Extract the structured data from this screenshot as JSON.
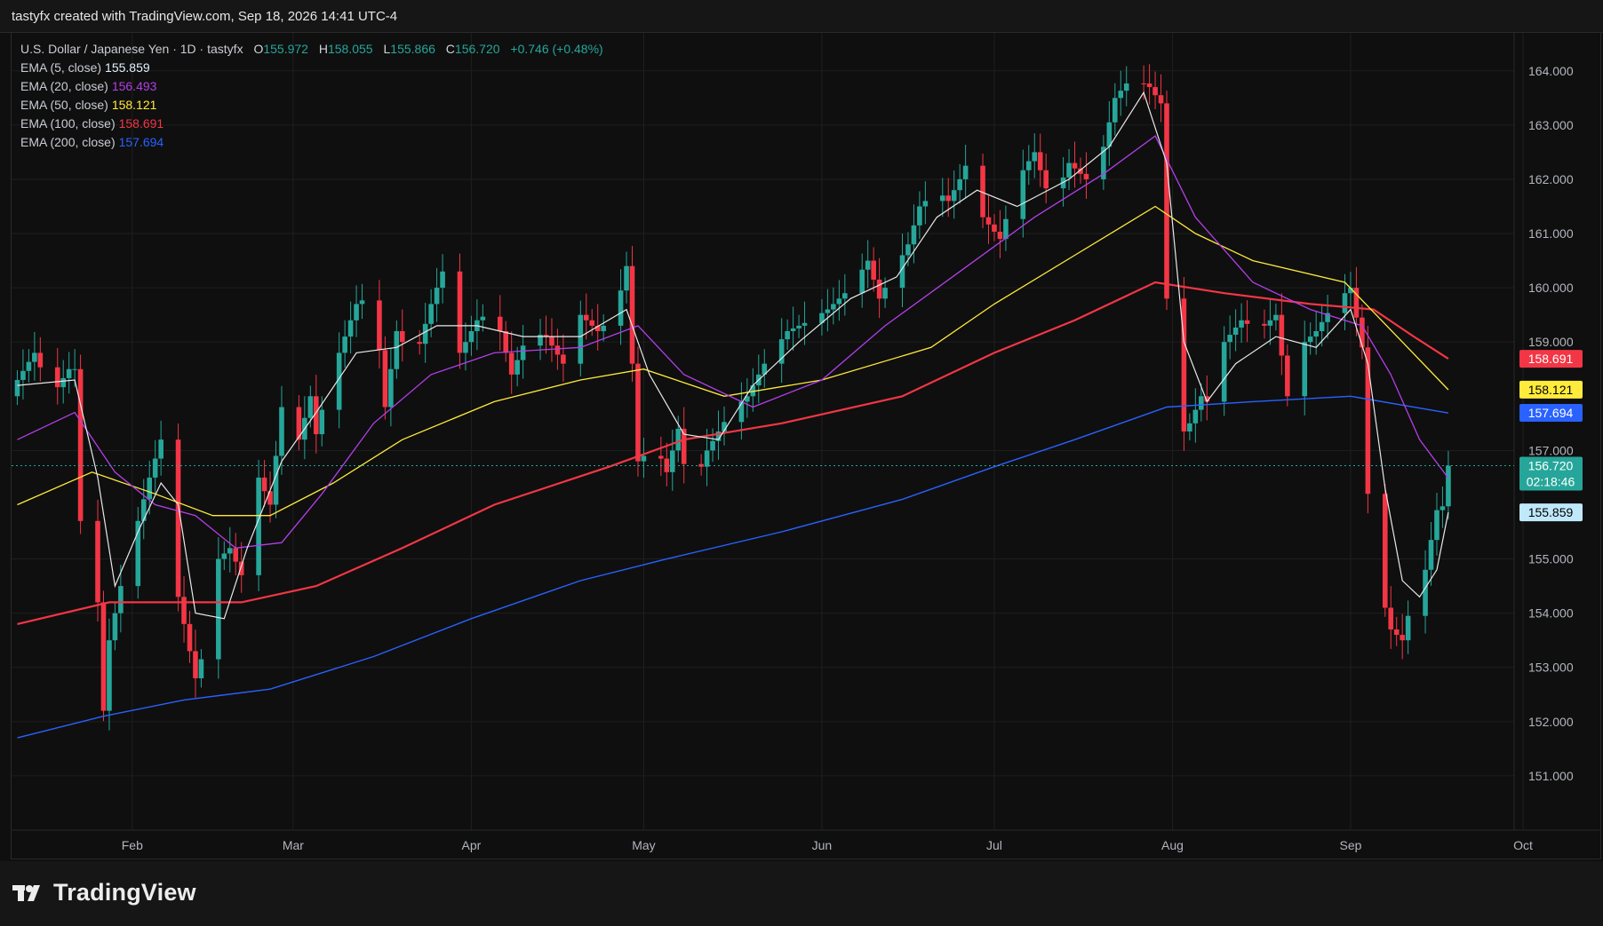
{
  "header": {
    "credit": "tastyfx created with TradingView.com, Sep 18, 2026 14:41 UTC-4"
  },
  "legend": {
    "symbol": "U.S. Dollar / Japanese Yen · 1D · tastyfx",
    "ohlc": [
      {
        "k": "O",
        "v": "155.972"
      },
      {
        "k": "H",
        "v": "158.055"
      },
      {
        "k": "L",
        "v": "155.866"
      },
      {
        "k": "C",
        "v": "156.720"
      }
    ],
    "change": "+0.746 (+0.48%)",
    "indicators": [
      {
        "label": "EMA (5, close)",
        "value": "155.859",
        "color": "#e0f0ff"
      },
      {
        "label": "EMA (20, close)",
        "value": "156.493",
        "color": "#b23fe8"
      },
      {
        "label": "EMA (50, close)",
        "value": "158.121",
        "color": "#ffeb3b"
      },
      {
        "label": "EMA (100, close)",
        "value": "158.691",
        "color": "#f23645"
      },
      {
        "label": "EMA (200, close)",
        "value": "157.694",
        "color": "#2962ff"
      }
    ]
  },
  "brand": {
    "name": "TradingView",
    "icon": "tradingview-logo-icon"
  },
  "colors": {
    "up": "#26a69a",
    "down": "#f23645",
    "background": "#0f0f0f",
    "grid": "#1f1f1f",
    "ema5": "#e8e8e8",
    "ema20": "#b23fe8",
    "ema50": "#ffeb3b",
    "ema100": "#f23645",
    "ema200": "#2962ff"
  },
  "chart_data": {
    "type": "candlestick",
    "title": "U.S. Dollar / Japanese Yen · 1D · tastyfx",
    "ylim": [
      150.0,
      164.7
    ],
    "y_ticks": [
      "151.000",
      "152.000",
      "153.000",
      "154.000",
      "155.000",
      "157.000",
      "159.000",
      "160.000",
      "161.000",
      "162.000",
      "163.000",
      "164.000"
    ],
    "x_ticks": [
      {
        "label": "Feb",
        "date": "2026-02-01"
      },
      {
        "label": "Mar",
        "date": "2026-03-01"
      },
      {
        "label": "Apr",
        "date": "2026-04-01"
      },
      {
        "label": "May",
        "date": "2026-05-01"
      },
      {
        "label": "Jun",
        "date": "2026-06-01"
      },
      {
        "label": "Jul",
        "date": "2026-07-01"
      },
      {
        "label": "Aug",
        "date": "2026-08-01"
      },
      {
        "label": "Sep",
        "date": "2026-09-01"
      },
      {
        "label": "Oct",
        "date": "2026-10-01"
      }
    ],
    "x_range": [
      "2026-01-11",
      "2026-10-01"
    ],
    "grid": true,
    "last_price": {
      "value": 156.72,
      "label": "156.720",
      "countdown": "02:18:46"
    },
    "price_labels": [
      {
        "label": "158.691",
        "value": 158.691,
        "color": "#f23645",
        "text_color": "#ffffff"
      },
      {
        "label": "158.121",
        "value": 158.121,
        "color": "#ffeb3b",
        "text_color": "#000000"
      },
      {
        "label": "157.694",
        "value": 157.694,
        "color": "#2962ff",
        "text_color": "#ffffff"
      },
      {
        "label": "156.493",
        "value": 156.493,
        "color": "#b23fe8",
        "text_color": "#ffffff"
      },
      {
        "label": "155.859",
        "value": 155.859,
        "color": "#bfe8fb",
        "text_color": "#000000"
      }
    ],
    "price_path": [
      [
        "2026-01-12",
        158.3
      ],
      [
        "2026-01-15",
        158.8
      ],
      [
        "2026-01-18",
        158.0
      ],
      [
        "2026-01-21",
        158.5
      ],
      [
        "2026-01-22",
        158.5
      ],
      [
        "2026-01-23",
        155.7
      ],
      [
        "2026-01-26",
        154.2
      ],
      [
        "2026-01-27",
        152.2
      ],
      [
        "2026-01-28",
        153.5
      ],
      [
        "2026-01-30",
        154.5
      ],
      [
        "2026-02-02",
        155.7
      ],
      [
        "2026-02-04",
        156.5
      ],
      [
        "2026-02-06",
        157.2
      ],
      [
        "2026-02-08",
        157.3
      ],
      [
        "2026-02-09",
        154.3
      ],
      [
        "2026-02-12",
        152.8
      ],
      [
        "2026-02-14",
        153.5
      ],
      [
        "2026-02-16",
        155.0
      ],
      [
        "2026-02-18",
        155.2
      ],
      [
        "2026-02-20",
        154.7
      ],
      [
        "2026-02-23",
        156.5
      ],
      [
        "2026-02-25",
        156.0
      ],
      [
        "2026-02-27",
        157.8
      ],
      [
        "2026-03-02",
        157.2
      ],
      [
        "2026-03-04",
        158.0
      ],
      [
        "2026-03-05",
        157.3
      ],
      [
        "2026-03-07",
        158.2
      ],
      [
        "2026-03-10",
        159.1
      ],
      [
        "2026-03-12",
        159.7
      ],
      [
        "2026-03-15",
        159.9
      ],
      [
        "2026-03-17",
        157.8
      ],
      [
        "2026-03-19",
        159.2
      ],
      [
        "2026-03-22",
        158.6
      ],
      [
        "2026-03-25",
        159.7
      ],
      [
        "2026-03-27",
        160.3
      ],
      [
        "2026-03-29",
        158.6
      ],
      [
        "2026-04-02",
        159.4
      ],
      [
        "2026-04-05",
        159.6
      ],
      [
        "2026-04-08",
        158.4
      ],
      [
        "2026-04-11",
        159.2
      ],
      [
        "2026-04-14",
        159.1
      ],
      [
        "2026-04-17",
        158.6
      ],
      [
        "2026-04-20",
        159.5
      ],
      [
        "2026-04-23",
        159.2
      ],
      [
        "2026-04-26",
        159.5
      ],
      [
        "2026-04-28",
        160.4
      ],
      [
        "2026-04-30",
        156.8
      ],
      [
        "2026-05-03",
        157.1
      ],
      [
        "2026-05-05",
        156.6
      ],
      [
        "2026-05-07",
        157.4
      ],
      [
        "2026-05-09",
        156.1
      ],
      [
        "2026-05-12",
        157.0
      ],
      [
        "2026-05-16",
        157.7
      ],
      [
        "2026-05-19",
        158.0
      ],
      [
        "2026-05-22",
        158.6
      ],
      [
        "2026-05-26",
        159.2
      ],
      [
        "2026-05-30",
        159.4
      ],
      [
        "2026-06-02",
        159.6
      ],
      [
        "2026-06-06",
        160.0
      ],
      [
        "2026-06-09",
        160.5
      ],
      [
        "2026-06-11",
        159.8
      ],
      [
        "2026-06-14",
        160.4
      ],
      [
        "2026-06-16",
        160.8
      ],
      [
        "2026-06-18",
        161.5
      ],
      [
        "2026-06-21",
        161.8
      ],
      [
        "2026-06-23",
        161.6
      ],
      [
        "2026-06-25",
        162.0
      ],
      [
        "2026-06-27",
        162.5
      ],
      [
        "2026-06-29",
        161.3
      ],
      [
        "2026-07-02",
        160.9
      ],
      [
        "2026-07-05",
        162.0
      ],
      [
        "2026-07-08",
        162.5
      ],
      [
        "2026-07-11",
        161.5
      ],
      [
        "2026-07-14",
        162.3
      ],
      [
        "2026-07-17",
        162.0
      ],
      [
        "2026-07-20",
        162.6
      ],
      [
        "2026-07-22",
        163.5
      ],
      [
        "2026-07-25",
        163.9
      ],
      [
        "2026-07-28",
        163.7
      ],
      [
        "2026-07-30",
        163.4
      ],
      [
        "2026-07-31",
        159.8
      ],
      [
        "2026-08-02",
        157.2
      ],
      [
        "2026-08-04",
        157.5
      ],
      [
        "2026-08-06",
        158.0
      ],
      [
        "2026-08-08",
        157.8
      ],
      [
        "2026-08-10",
        159.0
      ],
      [
        "2026-08-13",
        159.4
      ],
      [
        "2026-08-16",
        159.2
      ],
      [
        "2026-08-19",
        159.5
      ],
      [
        "2026-08-21",
        158.0
      ],
      [
        "2026-08-23",
        158.9
      ],
      [
        "2026-08-26",
        159.2
      ],
      [
        "2026-08-29",
        159.7
      ],
      [
        "2026-09-01",
        160.0
      ],
      [
        "2026-09-03",
        158.9
      ],
      [
        "2026-09-04",
        156.2
      ],
      [
        "2026-09-06",
        154.5
      ],
      [
        "2026-09-08",
        153.7
      ],
      [
        "2026-09-10",
        153.5
      ],
      [
        "2026-09-12",
        154.4
      ],
      [
        "2026-09-14",
        154.8
      ],
      [
        "2026-09-16",
        155.9
      ],
      [
        "2026-09-17",
        155.97
      ],
      [
        "2026-09-18",
        156.72
      ]
    ],
    "ema5": [
      [
        "2026-01-12",
        158.2
      ],
      [
        "2026-01-22",
        158.3
      ],
      [
        "2026-01-26",
        156.5
      ],
      [
        "2026-01-29",
        154.5
      ],
      [
        "2026-02-02",
        155.5
      ],
      [
        "2026-02-06",
        156.4
      ],
      [
        "2026-02-09",
        156.0
      ],
      [
        "2026-02-12",
        154.0
      ],
      [
        "2026-02-17",
        153.9
      ],
      [
        "2026-02-21",
        155.2
      ],
      [
        "2026-02-27",
        156.8
      ],
      [
        "2026-03-05",
        157.7
      ],
      [
        "2026-03-12",
        158.8
      ],
      [
        "2026-03-19",
        158.9
      ],
      [
        "2026-03-26",
        159.3
      ],
      [
        "2026-04-02",
        159.3
      ],
      [
        "2026-04-10",
        159.1
      ],
      [
        "2026-04-20",
        159.1
      ],
      [
        "2026-04-28",
        159.6
      ],
      [
        "2026-05-02",
        158.4
      ],
      [
        "2026-05-08",
        157.3
      ],
      [
        "2026-05-14",
        157.2
      ],
      [
        "2026-05-20",
        158.2
      ],
      [
        "2026-05-28",
        159.0
      ],
      [
        "2026-06-06",
        159.8
      ],
      [
        "2026-06-14",
        160.2
      ],
      [
        "2026-06-21",
        161.3
      ],
      [
        "2026-06-28",
        161.8
      ],
      [
        "2026-07-05",
        161.5
      ],
      [
        "2026-07-14",
        162.0
      ],
      [
        "2026-07-21",
        162.6
      ],
      [
        "2026-07-27",
        163.6
      ],
      [
        "2026-07-31",
        162.3
      ],
      [
        "2026-08-03",
        159.0
      ],
      [
        "2026-08-07",
        157.9
      ],
      [
        "2026-08-12",
        158.6
      ],
      [
        "2026-08-19",
        159.1
      ],
      [
        "2026-08-26",
        158.9
      ],
      [
        "2026-09-01",
        159.6
      ],
      [
        "2026-09-04",
        158.6
      ],
      [
        "2026-09-07",
        156.3
      ],
      [
        "2026-09-10",
        154.6
      ],
      [
        "2026-09-13",
        154.3
      ],
      [
        "2026-09-16",
        154.8
      ],
      [
        "2026-09-18",
        155.86
      ]
    ],
    "ema20": [
      [
        "2026-01-12",
        157.2
      ],
      [
        "2026-01-22",
        157.7
      ],
      [
        "2026-01-29",
        156.6
      ],
      [
        "2026-02-05",
        156.0
      ],
      [
        "2026-02-12",
        155.8
      ],
      [
        "2026-02-19",
        155.2
      ],
      [
        "2026-02-27",
        155.3
      ],
      [
        "2026-03-06",
        156.2
      ],
      [
        "2026-03-15",
        157.5
      ],
      [
        "2026-03-25",
        158.4
      ],
      [
        "2026-04-05",
        158.8
      ],
      [
        "2026-04-20",
        158.9
      ],
      [
        "2026-04-30",
        159.3
      ],
      [
        "2026-05-08",
        158.4
      ],
      [
        "2026-05-20",
        157.8
      ],
      [
        "2026-06-01",
        158.3
      ],
      [
        "2026-06-12",
        159.3
      ],
      [
        "2026-06-25",
        160.3
      ],
      [
        "2026-07-08",
        161.3
      ],
      [
        "2026-07-20",
        162.1
      ],
      [
        "2026-07-29",
        162.8
      ],
      [
        "2026-08-05",
        161.3
      ],
      [
        "2026-08-15",
        160.1
      ],
      [
        "2026-08-25",
        159.6
      ],
      [
        "2026-09-03",
        159.3
      ],
      [
        "2026-09-08",
        158.4
      ],
      [
        "2026-09-13",
        157.2
      ],
      [
        "2026-09-18",
        156.49
      ]
    ],
    "ema50": [
      [
        "2026-01-12",
        156.0
      ],
      [
        "2026-01-25",
        156.6
      ],
      [
        "2026-02-05",
        156.2
      ],
      [
        "2026-02-15",
        155.8
      ],
      [
        "2026-02-25",
        155.8
      ],
      [
        "2026-03-08",
        156.4
      ],
      [
        "2026-03-20",
        157.2
      ],
      [
        "2026-04-05",
        157.9
      ],
      [
        "2026-04-20",
        158.3
      ],
      [
        "2026-05-01",
        158.5
      ],
      [
        "2026-05-15",
        158.0
      ],
      [
        "2026-06-01",
        158.3
      ],
      [
        "2026-06-20",
        158.9
      ],
      [
        "2026-07-01",
        159.7
      ],
      [
        "2026-07-15",
        160.6
      ],
      [
        "2026-07-29",
        161.5
      ],
      [
        "2026-08-05",
        161.0
      ],
      [
        "2026-08-15",
        160.5
      ],
      [
        "2026-08-31",
        160.1
      ],
      [
        "2026-09-10",
        159.0
      ],
      [
        "2026-09-18",
        158.12
      ]
    ],
    "ema100": [
      [
        "2026-01-12",
        153.8
      ],
      [
        "2026-01-28",
        154.2
      ],
      [
        "2026-02-08",
        154.2
      ],
      [
        "2026-02-20",
        154.2
      ],
      [
        "2026-03-05",
        154.5
      ],
      [
        "2026-03-20",
        155.2
      ],
      [
        "2026-04-05",
        156.0
      ],
      [
        "2026-04-25",
        156.7
      ],
      [
        "2026-05-08",
        157.2
      ],
      [
        "2026-05-25",
        157.5
      ],
      [
        "2026-06-15",
        158.0
      ],
      [
        "2026-07-01",
        158.8
      ],
      [
        "2026-07-15",
        159.4
      ],
      [
        "2026-07-29",
        160.1
      ],
      [
        "2026-08-10",
        159.9
      ],
      [
        "2026-08-25",
        159.7
      ],
      [
        "2026-09-05",
        159.6
      ],
      [
        "2026-09-12",
        159.1
      ],
      [
        "2026-09-18",
        158.69
      ]
    ],
    "ema200": [
      [
        "2026-01-12",
        151.7
      ],
      [
        "2026-01-27",
        152.1
      ],
      [
        "2026-02-10",
        152.4
      ],
      [
        "2026-02-25",
        152.6
      ],
      [
        "2026-03-15",
        153.2
      ],
      [
        "2026-04-01",
        153.9
      ],
      [
        "2026-04-20",
        154.6
      ],
      [
        "2026-05-05",
        155.0
      ],
      [
        "2026-05-25",
        155.5
      ],
      [
        "2026-06-15",
        156.1
      ],
      [
        "2026-07-01",
        156.7
      ],
      [
        "2026-07-15",
        157.2
      ],
      [
        "2026-07-31",
        157.8
      ],
      [
        "2026-08-15",
        157.9
      ],
      [
        "2026-09-01",
        158.0
      ],
      [
        "2026-09-18",
        157.69
      ]
    ]
  }
}
